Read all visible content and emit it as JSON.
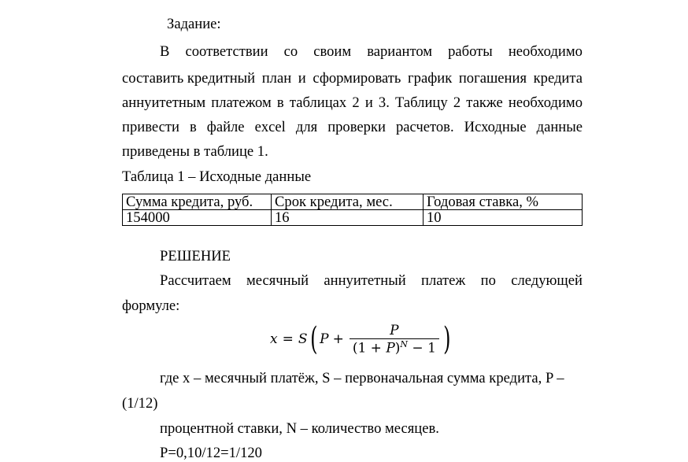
{
  "task_heading": "Задание:",
  "task_paragraph": {
    "line1": [
      "В",
      "соответствии",
      "со",
      "своим",
      "вариантом",
      "работы",
      "необходимо"
    ],
    "line2": [
      "составить кредитный",
      "план",
      "и",
      "сформировать",
      "график",
      "погашения",
      "кредита"
    ],
    "line3": [
      "аннуитетным",
      "платежом",
      "в",
      "таблицах",
      "2",
      "и",
      "3.",
      "Таблицу",
      "2",
      "также",
      "необходимо"
    ],
    "line4": [
      "привести",
      "в",
      "файле",
      "excel",
      "для",
      "проверки",
      "расчетов.",
      "Исходные",
      "данные"
    ],
    "line5": "приведены в таблице 1."
  },
  "table1": {
    "caption": "Таблица 1 – Исходные данные",
    "headers": [
      "Сумма кредита, руб.",
      "Срок кредита, мес.",
      "Годовая ставка, %"
    ],
    "rows": [
      [
        "154000",
        "16",
        "10"
      ]
    ]
  },
  "solution_heading": "РЕШЕНИЕ",
  "solution_intro": {
    "line1": [
      "Рассчитаем",
      "месячный",
      "аннуитетный",
      "платеж",
      "по",
      "следующей"
    ],
    "line2": "формуле:"
  },
  "formula": {
    "lhs": "x",
    "eq": "=",
    "s": "S",
    "p": "P",
    "plus": "+",
    "numerator": "P",
    "den_open": "(1 + ",
    "den_p": "P",
    "den_close": ")",
    "exp": "N",
    "den_tail": " − 1"
  },
  "explanation": {
    "line1": "где  x – месячный платёж, S – первоначальная сумма кредита, P –",
    "line2": "(1/12)",
    "line3": "процентной ставки, N – количество месяцев.",
    "line4": "P=0,10/12=1/120"
  }
}
